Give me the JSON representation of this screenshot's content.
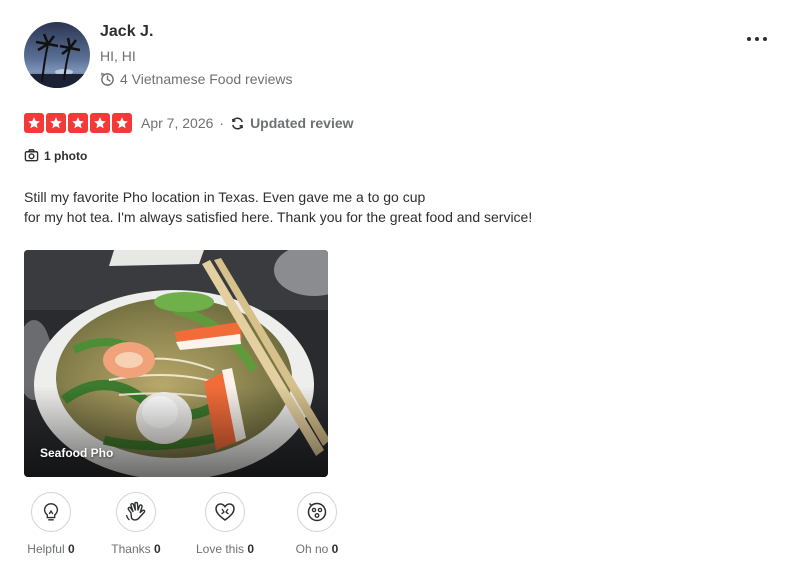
{
  "user": {
    "name": "Jack J.",
    "location": "HI, HI",
    "reviews_text": "4 Vietnamese Food reviews",
    "avatar_icon": "palm-tree-sunset-avatar"
  },
  "more_menu": {
    "label": "...",
    "icon": "more-horizontal-icon"
  },
  "rating": {
    "stars": 5,
    "max": 5,
    "color": "#f43939",
    "date": "Apr 7, 2026",
    "separator": "·",
    "updated_label": "Updated review"
  },
  "photo_count": "1 photo",
  "review": {
    "lines": [
      "Still my favorite Pho location in Texas. Even gave me a to go cup",
      "for my hot tea. I'm always satisfied here. Thank you for the great food and service!"
    ]
  },
  "photo": {
    "caption": "Seafood Pho"
  },
  "reactions": [
    {
      "label": "Helpful",
      "count": "0",
      "icon": "lightbulb-icon"
    },
    {
      "label": "Thanks",
      "count": "0",
      "icon": "waving-hand-icon"
    },
    {
      "label": "Love this",
      "count": "0",
      "icon": "heart-icon"
    },
    {
      "label": "Oh no",
      "count": "0",
      "icon": "surprised-face-icon"
    }
  ]
}
